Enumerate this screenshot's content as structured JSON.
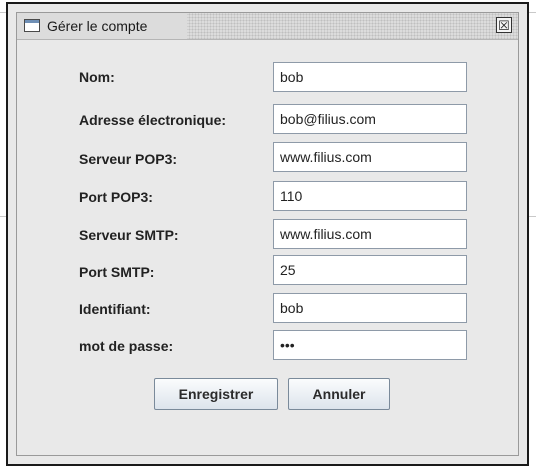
{
  "dialog": {
    "title": "Gérer le compte",
    "close_glyph": "☒"
  },
  "form": {
    "fields": [
      {
        "label": "Nom:",
        "value": "bob"
      },
      {
        "label": "Adresse électronique:",
        "value": "bob@filius.com"
      },
      {
        "label": "Serveur POP3:",
        "value": "www.filius.com"
      },
      {
        "label": "Port POP3:",
        "value": "110"
      },
      {
        "label": "Serveur SMTP:",
        "value": "www.filius.com"
      },
      {
        "label": "Port SMTP:",
        "value": "25"
      },
      {
        "label": "Identifiant:",
        "value": "bob"
      },
      {
        "label": "mot de passe:",
        "value": "bob"
      }
    ]
  },
  "buttons": {
    "save": "Enregistrer",
    "cancel": "Annuler"
  }
}
